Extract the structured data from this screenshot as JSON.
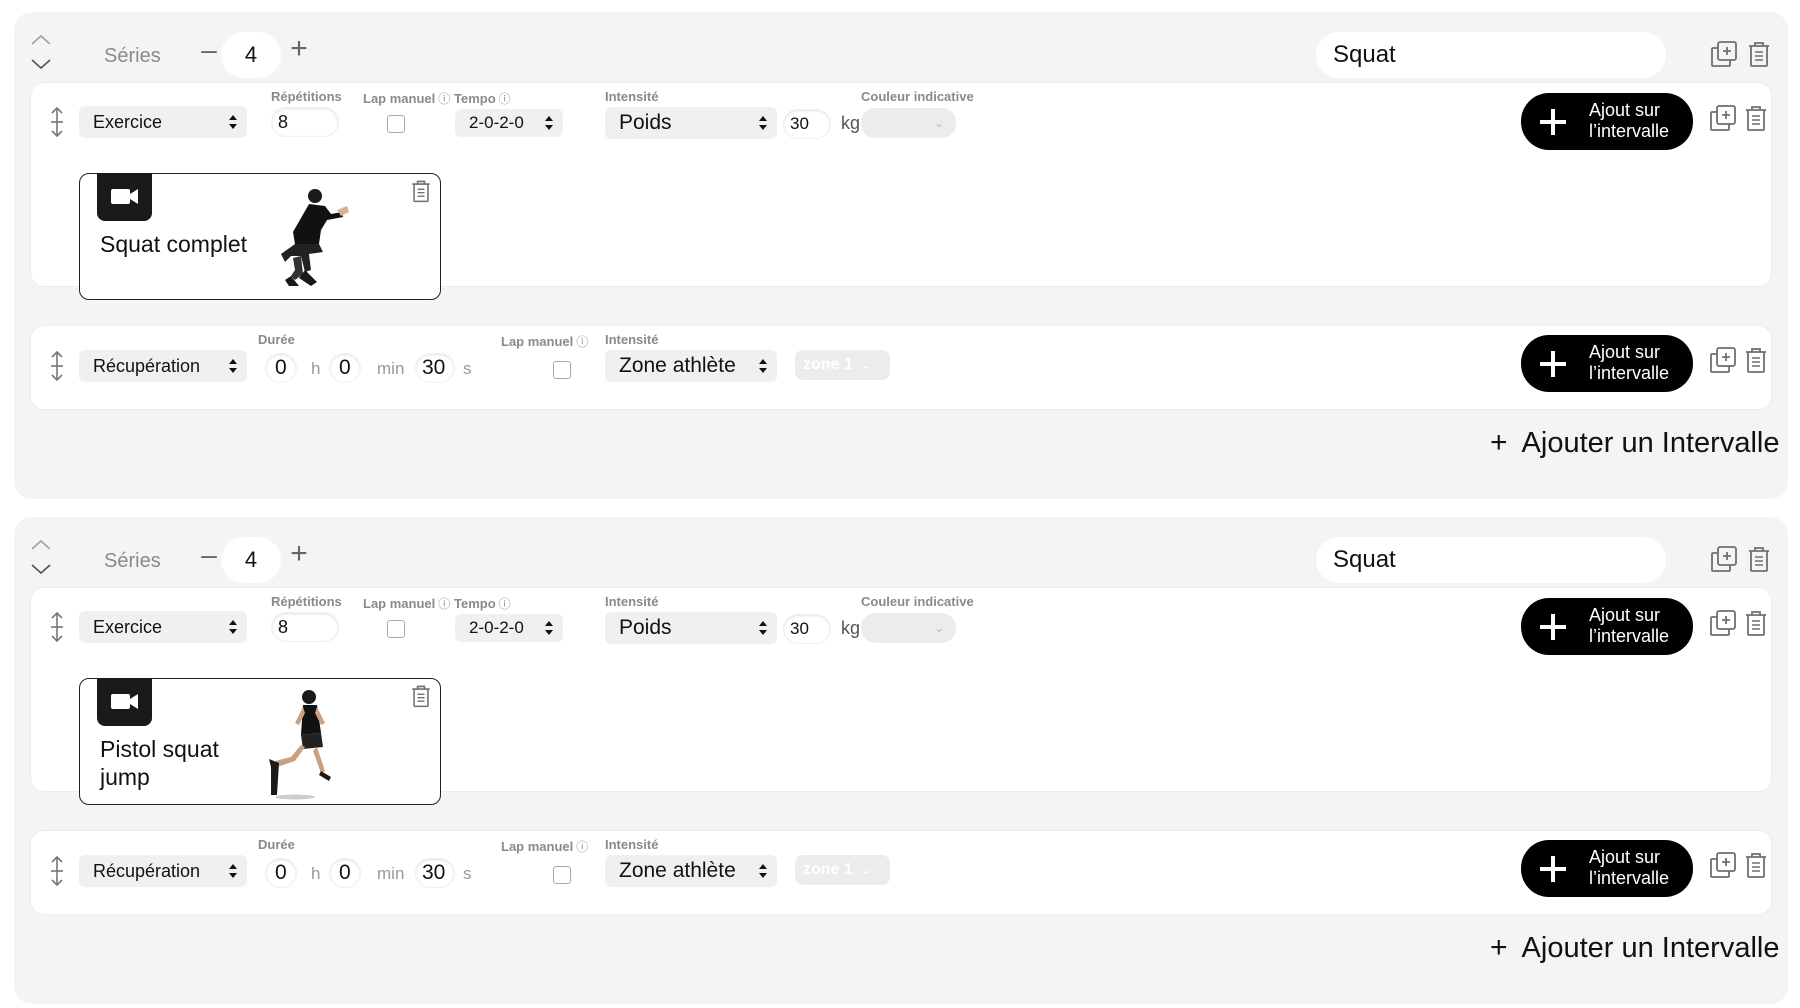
{
  "blocks": [
    {
      "series_label": "Séries",
      "series_count": "4",
      "name": "Squat",
      "exercise": {
        "type": "Exercice",
        "labels": {
          "reps": "Répétitions",
          "lap": "Lap manuel",
          "tempo": "Tempo",
          "intensity": "Intensité",
          "color": "Couleur indicative"
        },
        "reps": "8",
        "tempo": "2-0-2-0",
        "intensity_type": "Poids",
        "intensity_value": "30",
        "intensity_unit": "kg",
        "add_button": [
          "Ajout sur",
          "l’intervalle"
        ],
        "video": {
          "title": "Squat complet",
          "figure": "squat"
        }
      },
      "recovery": {
        "type": "Récupération",
        "labels": {
          "duration": "Durée",
          "lap": "Lap manuel",
          "intensity": "Intensité"
        },
        "h": "0",
        "h_unit": "h",
        "min": "0",
        "min_unit": "min",
        "s": "30",
        "s_unit": "s",
        "intensity_type": "Zone athlète",
        "zone": "zone 1",
        "add_button": [
          "Ajout sur",
          "l’intervalle"
        ]
      },
      "add_interval": "Ajouter un Intervalle"
    },
    {
      "series_label": "Séries",
      "series_count": "4",
      "name": "Squat",
      "exercise": {
        "type": "Exercice",
        "labels": {
          "reps": "Répétitions",
          "lap": "Lap manuel",
          "tempo": "Tempo",
          "intensity": "Intensité",
          "color": "Couleur indicative"
        },
        "reps": "8",
        "tempo": "2-0-2-0",
        "intensity_type": "Poids",
        "intensity_value": "30",
        "intensity_unit": "kg",
        "add_button": [
          "Ajout sur",
          "l’intervalle"
        ],
        "video": {
          "title": "Pistol squat jump",
          "figure": "jump"
        }
      },
      "recovery": {
        "type": "Récupération",
        "labels": {
          "duration": "Durée",
          "lap": "Lap manuel",
          "intensity": "Intensité"
        },
        "h": "0",
        "h_unit": "h",
        "min": "0",
        "min_unit": "min",
        "s": "30",
        "s_unit": "s",
        "intensity_type": "Zone athlète",
        "zone": "zone 1",
        "add_button": [
          "Ajout sur",
          "l’intervalle"
        ]
      },
      "add_interval": "Ajouter un Intervalle"
    }
  ],
  "icons": {
    "collapse": "collapse-chevrons-icon",
    "duplicate": "duplicate-icon",
    "delete": "trash-icon",
    "drag": "drag-handle-icon",
    "select_arrows": "select-arrows-icon",
    "info": "info-icon",
    "plus": "plus-icon",
    "camera": "video-camera-icon",
    "chevron": "chevron-down-icon"
  },
  "colors": {
    "block_bg": "#f4f4f4",
    "card_bg": "#ffffff",
    "button_bg": "#000000",
    "label": "#8a8a8a"
  }
}
